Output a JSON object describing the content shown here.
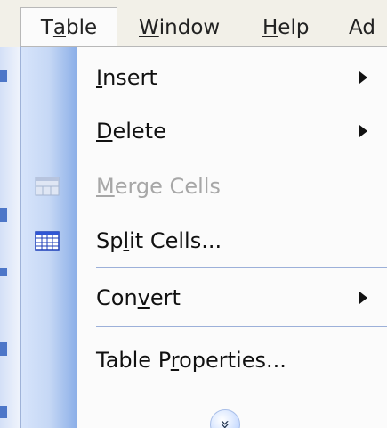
{
  "menubar": {
    "fragment": "",
    "items": [
      {
        "label_prefix": "T",
        "label_underline": "a",
        "label_suffix": "ble"
      },
      {
        "label_prefix": "",
        "label_underline": "W",
        "label_suffix": "indow"
      },
      {
        "label_prefix": "",
        "label_underline": "H",
        "label_suffix": "elp"
      },
      {
        "label_prefix": "Ad",
        "label_underline": "",
        "label_suffix": ""
      }
    ]
  },
  "dropdown": {
    "items": [
      {
        "prefix": "",
        "underline": "I",
        "suffix": "nsert",
        "disabled": false,
        "has_submenu": true,
        "icon": ""
      },
      {
        "prefix": "",
        "underline": "D",
        "suffix": "elete",
        "disabled": false,
        "has_submenu": true,
        "icon": ""
      },
      {
        "prefix": "",
        "underline": "M",
        "suffix": "erge Cells",
        "disabled": true,
        "has_submenu": false,
        "icon": "merge-cells-icon"
      },
      {
        "prefix": "Sp",
        "underline": "l",
        "suffix": "it Cells...",
        "disabled": false,
        "has_submenu": false,
        "icon": "split-cells-icon"
      },
      {
        "prefix": "Con",
        "underline": "v",
        "suffix": "ert",
        "disabled": false,
        "has_submenu": true,
        "icon": ""
      },
      {
        "prefix": "Table P",
        "underline": "r",
        "suffix": "operties...",
        "disabled": false,
        "has_submenu": false,
        "icon": ""
      }
    ],
    "expand_glyph": "»"
  },
  "colors": {
    "menu_background": "#fbfbfb",
    "icon_bar_light": "#d7e4fb",
    "icon_bar_dark": "#8cafe8",
    "separator": "#9cb0d9",
    "disabled_text": "#a7a7a7"
  }
}
